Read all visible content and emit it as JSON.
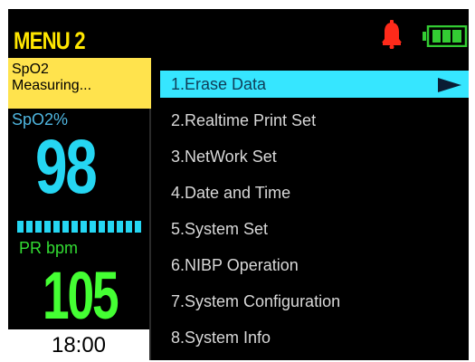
{
  "header": {
    "title": "MENU 2",
    "alarm_icon": "bell-icon",
    "battery_icon": "battery-full-icon"
  },
  "status": {
    "line1": "SpO2",
    "line2": "Measuring..."
  },
  "vitals": {
    "spo2_label": "SpO2%",
    "spo2_value": "98",
    "pr_label": "PR bpm",
    "pr_value": "105"
  },
  "clock": "18:00",
  "menu": {
    "items": [
      {
        "label": "1.Erase Data"
      },
      {
        "label": "2.Realtime Print Set"
      },
      {
        "label": "3.NetWork Set"
      },
      {
        "label": "4.Date and Time"
      },
      {
        "label": "5.System Set"
      },
      {
        "label": "6.NIBP Operation"
      },
      {
        "label": "7.System Configuration"
      },
      {
        "label": "8.System Info"
      }
    ],
    "selected_index": 0
  },
  "colors": {
    "title": "#ffe600",
    "status_bg": "#ffe34d",
    "spo2": "#25d6f2",
    "pr": "#44ff33",
    "selection": "#36e6ff",
    "alarm": "#ff2a1a",
    "battery": "#33cc33"
  }
}
